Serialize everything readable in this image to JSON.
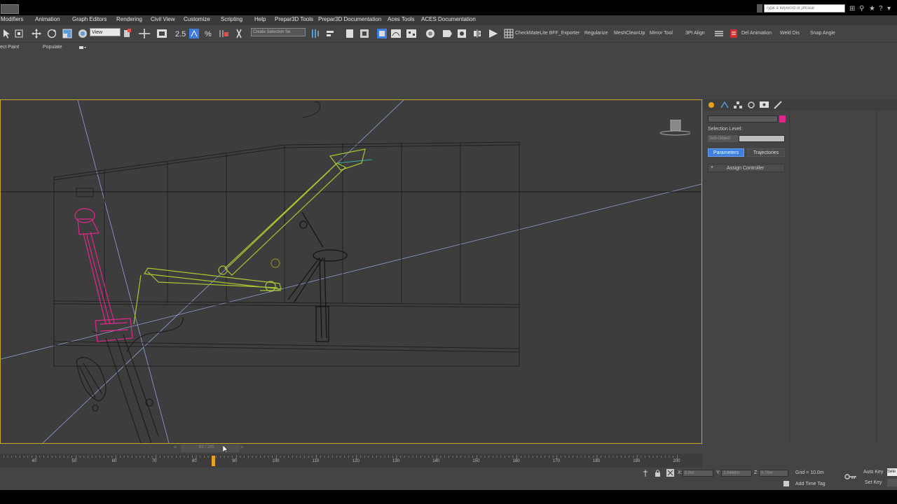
{
  "title_bar": {
    "search_placeholder": "Type a keyword or phrase"
  },
  "menu": {
    "items": [
      "Modifiers",
      "Animation",
      "Graph Editors",
      "Rendering",
      "Civil View",
      "Customize",
      "Scripting",
      "Help",
      "Prepar3D Tools",
      "Prepar3D Documentation",
      "Aces Tools",
      "ACES Documentation"
    ]
  },
  "toolbar": {
    "view_dropdown": "View",
    "selection_set_dropdown": "Create Selection Se",
    "scripts": [
      "CheckMateLite BFF_Exporter",
      "Regularize",
      "MeshCleanUp",
      "Mirror Tool",
      "3Pt Align",
      "Del Animation",
      "Weld Dis",
      "Snap Angle"
    ]
  },
  "ribbon": {
    "items": [
      "ect Paint",
      "Populate"
    ]
  },
  "command_panel": {
    "selection_level_label": "Selection Level:",
    "sub_object_label": "Sub-Object",
    "tabs": [
      "Parameters",
      "Trajectories"
    ],
    "rollout_label": "Assign Controller",
    "accent_color": "#3d7ee0",
    "swatch_color": "#e0288c"
  },
  "timeline": {
    "frame_label": "83 / 200",
    "prev": "<",
    "next": ">"
  },
  "trackbar": {
    "ticks": [
      "40",
      "50",
      "60",
      "70",
      "80",
      "90",
      "100",
      "110",
      "120",
      "130",
      "140",
      "150",
      "160",
      "170",
      "180",
      "190",
      "200"
    ],
    "current_frame": 83
  },
  "status": {
    "x_label": "X:",
    "x_value": "0.0m",
    "y_label": "Y:",
    "y_value": "2.0468m",
    "z_label": "Z:",
    "z_value": "0.75m",
    "grid": "Grid = 10.0m",
    "add_time_tag": "Add Time Tag",
    "auto_key": "Auto Key",
    "set_key": "Set Key",
    "selected": "Sele"
  },
  "colors": {
    "viewport_border": "#c8a626",
    "object_pink": "#e0288c",
    "object_yellow": "#a8c830"
  }
}
